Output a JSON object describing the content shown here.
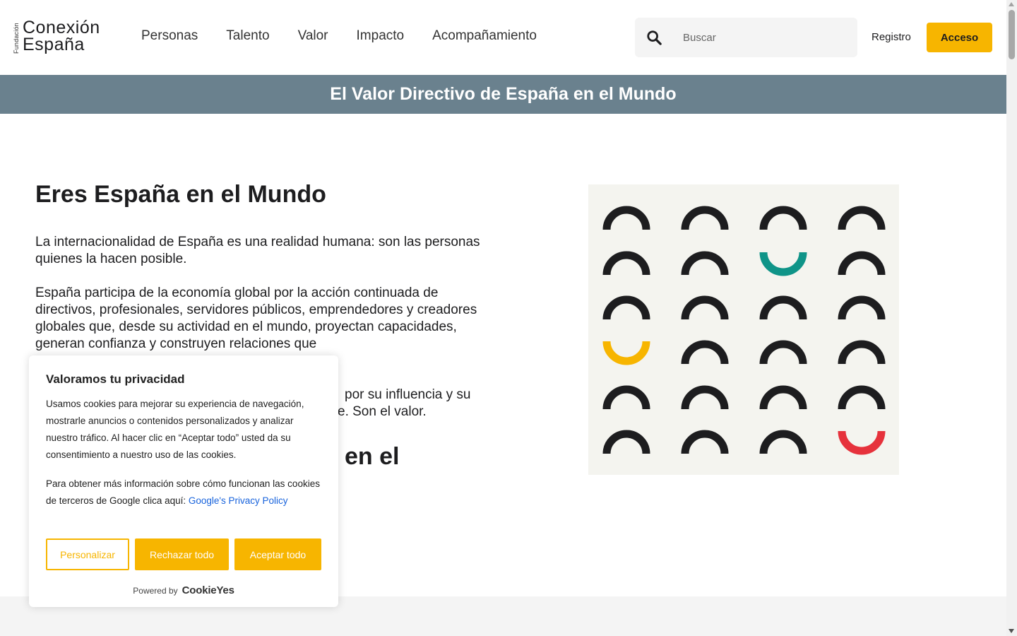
{
  "header": {
    "logo": {
      "vertical": "Fundación",
      "line1": "Conexión",
      "line2": "España",
      "accent_colors": [
        "#f7b500",
        "#e6323c"
      ]
    },
    "nav": [
      "Personas",
      "Talento",
      "Valor",
      "Impacto",
      "Acompañamiento"
    ],
    "search": {
      "placeholder": "Buscar",
      "value": "",
      "icon": "search-icon"
    },
    "registro_label": "Registro",
    "acceso_label": "Acceso"
  },
  "banner": {
    "title": "El Valor Directivo de España en el Mundo",
    "color": "#6a818e"
  },
  "main": {
    "title": "Eres España en el Mundo",
    "paragraph1": "La internacionalidad de España es una realidad humana: son las personas quienes la hacen posible.",
    "paragraph2": "España participa de la economía global por la acción continuada de directivos, profesionales, servidores públicos, emprendedores y creadores globales que, desde su actividad en el mundo, proyectan capacidades, generan confianza y construyen relaciones que",
    "paragraph3": "por su influencia y su",
    "paragraph3_line2": "e. Son el valor.",
    "subtitle": "en el"
  },
  "illustration": {
    "background": "#f4f4ef",
    "rows": [
      [
        "dark-up",
        "dark-up",
        "dark-up",
        "dark-up"
      ],
      [
        "dark-up",
        "dark-up",
        "teal-down",
        "dark-up"
      ],
      [
        "dark-up",
        "dark-up",
        "dark-up",
        "dark-up"
      ],
      [
        "yellow-down",
        "dark-up",
        "dark-up",
        "dark-up"
      ],
      [
        "dark-up",
        "dark-up",
        "dark-up",
        "dark-up"
      ],
      [
        "dark-up",
        "dark-up",
        "dark-up",
        "red-down"
      ]
    ],
    "colors": {
      "dark": "#1d1d1f",
      "teal": "#0f9488",
      "yellow": "#f7b500",
      "red": "#e6323c"
    }
  },
  "cookie": {
    "title": "Valoramos tu privacidad",
    "text1": "Usamos cookies para mejorar su experiencia de navegación, mostrarle anuncios o contenidos personalizados y analizar nuestro tráfico. Al hacer clic en “Aceptar todo” usted da su consentimiento a nuestro uso de las cookies.",
    "text2": "Para obtener más información sobre cómo funcionan las cookies de terceros de Google clica aquí:",
    "link": "Google's Privacy Policy",
    "buttons": {
      "personalizar": "Personalizar",
      "rechazar": "Rechazar todo",
      "aceptar": "Aceptar todo"
    },
    "powered_by": "Powered by",
    "brand": "CookieYes",
    "accent": "#f7b500"
  }
}
